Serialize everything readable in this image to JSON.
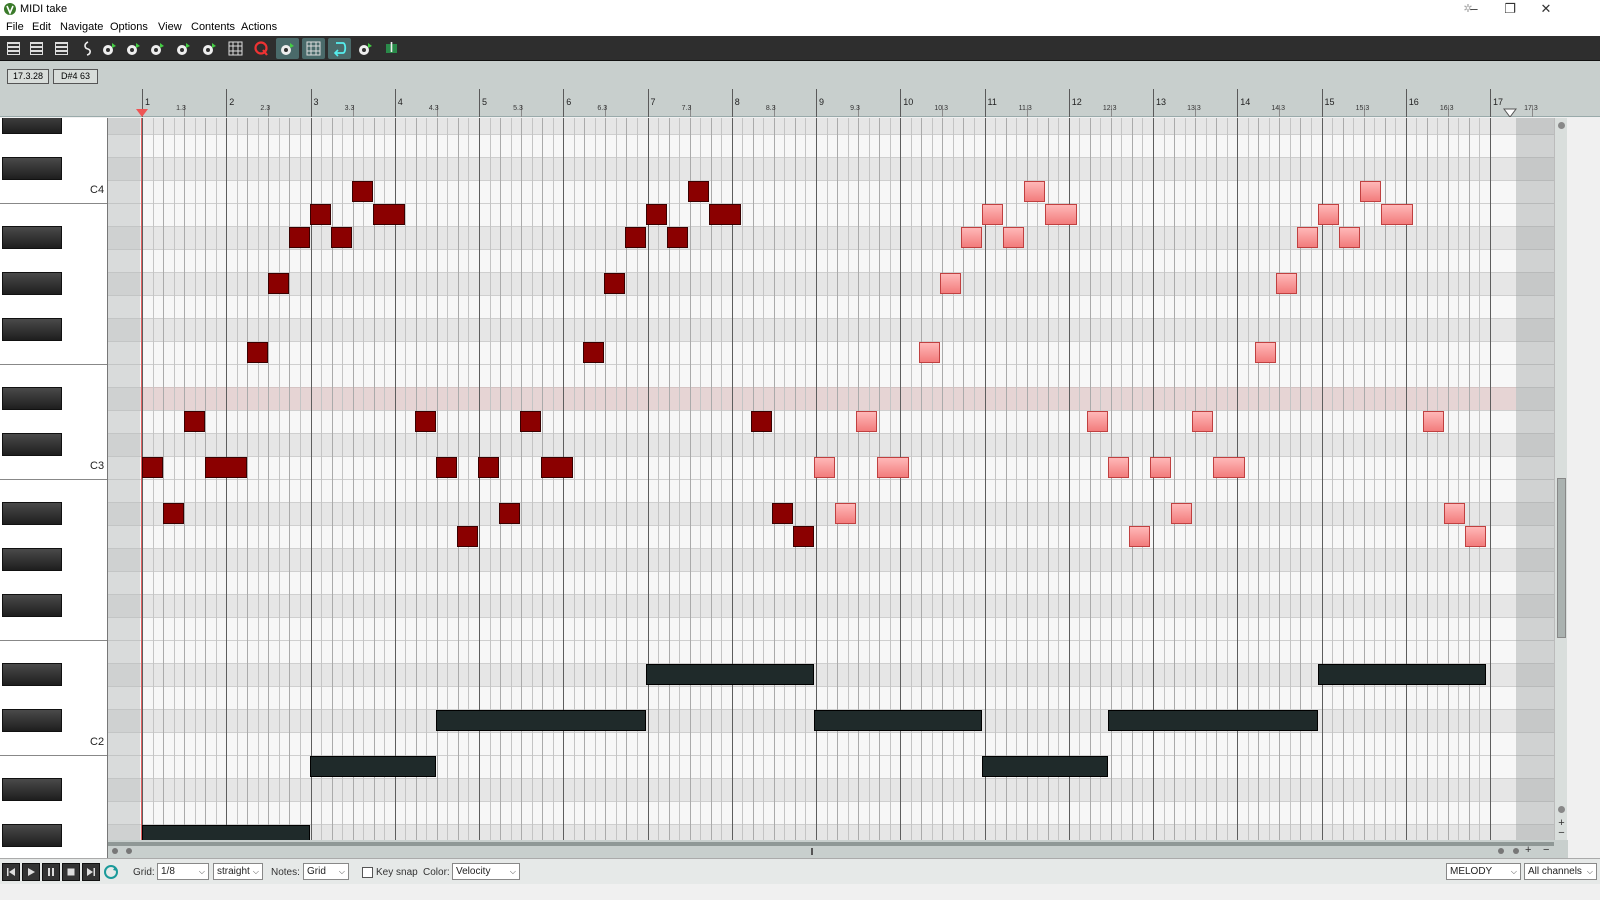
{
  "window": {
    "title": "MIDI take",
    "controls": {
      "minimize": "–",
      "maximize": "❐",
      "close": "✕"
    }
  },
  "menu": [
    "File",
    "Edit",
    "Navigate",
    "Options",
    "View",
    "Contents",
    "Actions"
  ],
  "toolbar": {
    "buttons": [
      {
        "icon": "list-view-icon",
        "active": false
      },
      {
        "icon": "event-list-icon",
        "active": false
      },
      {
        "icon": "piano-roll-icon",
        "active": false
      },
      {
        "icon": "notation-icon",
        "active": false
      },
      {
        "icon": "insert-note-icon",
        "active": false
      },
      {
        "icon": "play-icon",
        "active": false
      },
      {
        "icon": "record-icon",
        "active": false
      },
      {
        "icon": "step-input-icon",
        "active": false
      },
      {
        "icon": "chase-icon",
        "active": false
      },
      {
        "icon": "grid-view-icon",
        "active": false
      },
      {
        "icon": "quantize-icon",
        "active": false
      },
      {
        "icon": "snap-icon",
        "active": true
      },
      {
        "icon": "grid-snap-icon",
        "active": true
      },
      {
        "icon": "loop-icon",
        "active": true
      },
      {
        "icon": "sync-icon",
        "active": false
      },
      {
        "icon": "insert-event-icon",
        "active": false
      }
    ]
  },
  "info": {
    "position": "17.3.28",
    "note": "D#4 63"
  },
  "ruler": {
    "bars": [
      "1",
      "2",
      "3",
      "4",
      "5",
      "6",
      "7",
      "8",
      "9",
      "10",
      "11",
      "12",
      "13",
      "14",
      "15",
      "16",
      "17"
    ],
    "sub_labels": [
      "1.3",
      "2.3",
      "3.3",
      "4.3",
      "5.3",
      "6.3",
      "7.3",
      "8.3",
      "9.3",
      "10.3",
      "11.3",
      "12.3",
      "13.3",
      "14.3",
      "15.3",
      "16.3",
      "17.3"
    ]
  },
  "keys": {
    "labels": [
      "C4",
      "C3",
      "C2"
    ]
  },
  "bottom": {
    "grid_label": "Grid:",
    "grid_value": "1/8",
    "grid_type": "straight",
    "notes_label": "Notes:",
    "notes_value": "Grid",
    "keysnap_label": "Key snap",
    "color_label": "Color:",
    "color_value": "Velocity",
    "track_value": "MELODY",
    "channel_value": "All channels"
  },
  "colors": {
    "melody_dark": "#8b0000",
    "melody_light": "#f27c7c",
    "bass": "#1f2a2a"
  }
}
